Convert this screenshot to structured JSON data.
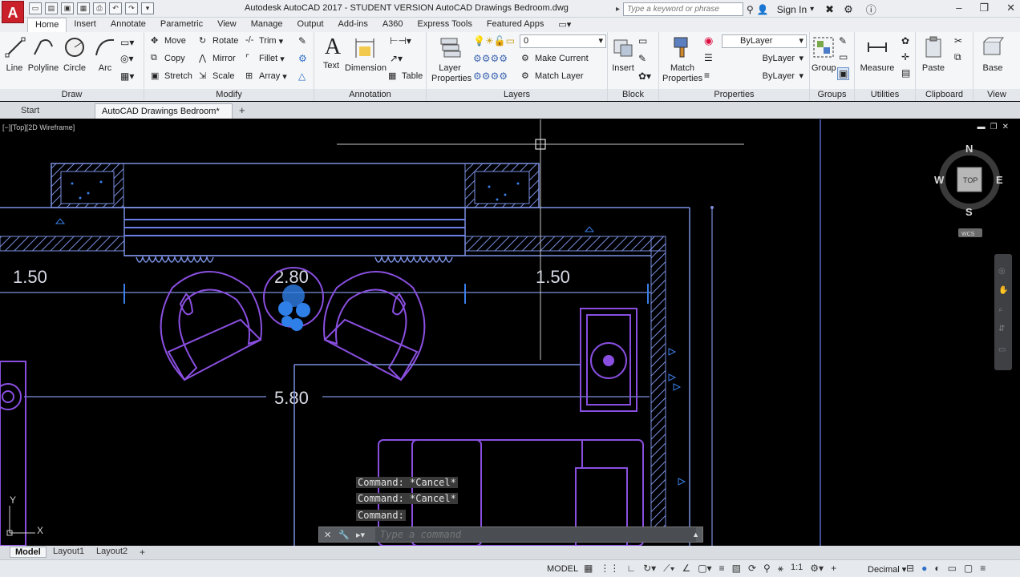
{
  "window": {
    "app_letter": "A",
    "title": "Autodesk AutoCAD 2017 - STUDENT VERSION    AutoCAD Drawings Bedroom.dwg",
    "search_placeholder": "Type a keyword or phrase",
    "sign_in": "Sign In"
  },
  "ribbon_tabs": [
    "Home",
    "Insert",
    "Annotate",
    "Parametric",
    "View",
    "Manage",
    "Output",
    "Add-ins",
    "A360",
    "Express Tools",
    "Featured Apps"
  ],
  "ribbon": {
    "draw": {
      "label": "Draw",
      "line": "Line",
      "polyline": "Polyline",
      "circle": "Circle",
      "arc": "Arc"
    },
    "modify": {
      "label": "Modify",
      "move": "Move",
      "rotate": "Rotate",
      "trim": "Trim",
      "copy": "Copy",
      "mirror": "Mirror",
      "fillet": "Fillet",
      "stretch": "Stretch",
      "scale": "Scale",
      "array": "Array"
    },
    "annotation": {
      "label": "Annotation",
      "text": "Text",
      "dimension": "Dimension",
      "table": "Table"
    },
    "layers": {
      "label": "Layers",
      "layer_properties": "Layer\nProperties",
      "current_layer": "0",
      "make_current": "Make Current",
      "match_layer": "Match Layer"
    },
    "block": {
      "label": "Block",
      "insert": "Insert"
    },
    "properties": {
      "label": "Properties",
      "match_properties": "Match\nProperties",
      "color": "ByLayer",
      "linetype": "ByLayer",
      "lineweight": "ByLayer"
    },
    "groups": {
      "label": "Groups",
      "group": "Group"
    },
    "utilities": {
      "label": "Utilities",
      "measure": "Measure"
    },
    "clipboard": {
      "label": "Clipboard",
      "paste": "Paste"
    },
    "view": {
      "label": "View",
      "base": "Base"
    }
  },
  "file_tabs": {
    "start": "Start",
    "drawing": "AutoCAD Drawings Bedroom*",
    "add": "+"
  },
  "viewport": {
    "label": "[−][Top][2D Wireframe]",
    "viewcube": {
      "top": "TOP",
      "n": "N",
      "s": "S",
      "e": "E",
      "w": "W",
      "wcs": "WCS"
    },
    "dimensions": {
      "left_width": "1.50",
      "center_width": "2.80",
      "right_width": "1.50",
      "total_width": "5.80"
    },
    "ucs": {
      "x": "X",
      "y": "Y"
    }
  },
  "command": {
    "history": [
      "Command: *Cancel*",
      "Command: *Cancel*",
      "Command:"
    ],
    "placeholder": "Type a command"
  },
  "layout_tabs": [
    "Model",
    "Layout1",
    "Layout2"
  ],
  "status": {
    "mode": "MODEL",
    "scale": "1:1",
    "units": "Decimal"
  },
  "colors": {
    "wall": "#7a8fe0",
    "furniture": "#8a4fe0",
    "dimension": "#7e8fd8",
    "plant": "#2f7fe8",
    "accent_red": "#c9202a"
  }
}
